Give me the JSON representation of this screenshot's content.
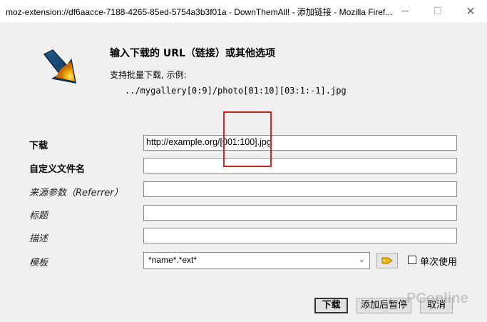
{
  "window": {
    "title": "moz-extension://df6aacce-7188-4265-85ed-5754a3b3f01a - DownThemAll! - 添加链接 - Mozilla Firef...",
    "minimize_glyph": "—",
    "close_glyph": "✕"
  },
  "header": {
    "heading": "输入下载的 URL（链接）或其他选项",
    "subheading": "支持批量下载, 示例:",
    "example": "../mygallery[0:9]/photo[01:10][03:1:-1].jpg"
  },
  "form": {
    "download": {
      "label": "下载",
      "value": "http://example.org/[001:100].jpg"
    },
    "custom_filename": {
      "label": "自定义文件名",
      "value": ""
    },
    "referrer": {
      "label": "来源参数（Referrer）",
      "value": ""
    },
    "title": {
      "label": "标题",
      "value": ""
    },
    "description": {
      "label": "描述",
      "value": ""
    },
    "template": {
      "label": "模板",
      "value": "*name*.*ext*",
      "once_label": "单次使用",
      "once_checked": false
    }
  },
  "buttons": {
    "download": "下载",
    "add_paused": "添加后暂停",
    "cancel": "取消"
  },
  "watermark": "PConline",
  "colors": {
    "highlight": "#e0201e",
    "dialog_bg": "#f0f0f0",
    "logo_accent": "#f2a900"
  },
  "icons": {
    "logo": "downthemall-arrow-icon",
    "tag": "tag-icon",
    "dropdown": "chevron-down-icon"
  }
}
